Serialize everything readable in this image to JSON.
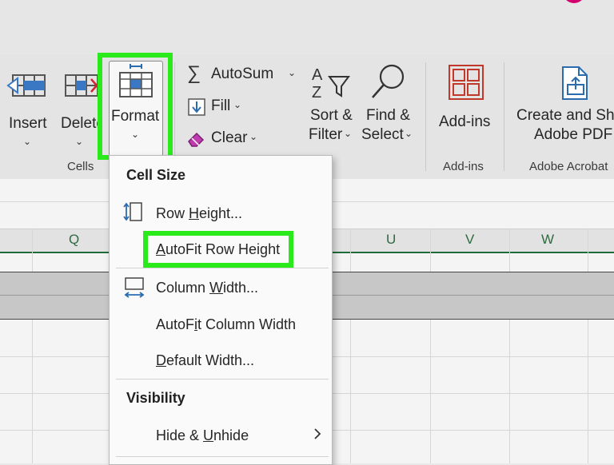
{
  "ribbon": {
    "insert_label": "Insert",
    "delete_label": "Delete",
    "format_label": "Format",
    "cells_group": "Cells",
    "autosum_label": "AutoSum",
    "fill_label": "Fill",
    "clear_label": "Clear",
    "sort_filter_line1": "Sort &",
    "sort_filter_line2": "Filter",
    "find_select_line1": "Find &",
    "find_select_line2": "Select",
    "addins_label": "Add-ins",
    "addins_group": "Add-ins",
    "create_pdf_line1": "Create and Sha",
    "create_pdf_line2": "Adobe PDF",
    "adobe_group": "Adobe Acrobat"
  },
  "grid": {
    "columns": [
      "Q",
      "U",
      "V",
      "W"
    ]
  },
  "format_menu": {
    "cell_size_heading": "Cell Size",
    "items": [
      {
        "pre": "Row ",
        "acc": "H",
        "post": "eight..."
      },
      {
        "pre": "",
        "acc": "A",
        "post": "utoFit Row Height"
      },
      {
        "pre": "Column ",
        "acc": "W",
        "post": "idth..."
      },
      {
        "pre": "AutoF",
        "acc": "i",
        "post": "t Column Width"
      },
      {
        "pre": "",
        "acc": "D",
        "post": "efault Width..."
      }
    ],
    "visibility_heading": "Visibility",
    "hide_unhide": {
      "pre": "Hide & ",
      "acc": "U",
      "post": "nhide"
    }
  },
  "colors": {
    "highlight": "#2bea1c",
    "grid_header_accent": "#1f6b3a",
    "delete_x": "#d1242f",
    "addins_icon": "#c0392b",
    "icon_blue": "#2b6cb0"
  },
  "icons": [
    "insert-cells-icon",
    "delete-cells-icon",
    "format-cells-icon",
    "autosum-icon",
    "fill-down-icon",
    "clear-eraser-icon",
    "sort-filter-icon",
    "find-magnifier-icon",
    "addins-grid-icon",
    "create-pdf-icon",
    "row-height-icon",
    "column-width-icon",
    "submenu-arrow-icon"
  ]
}
